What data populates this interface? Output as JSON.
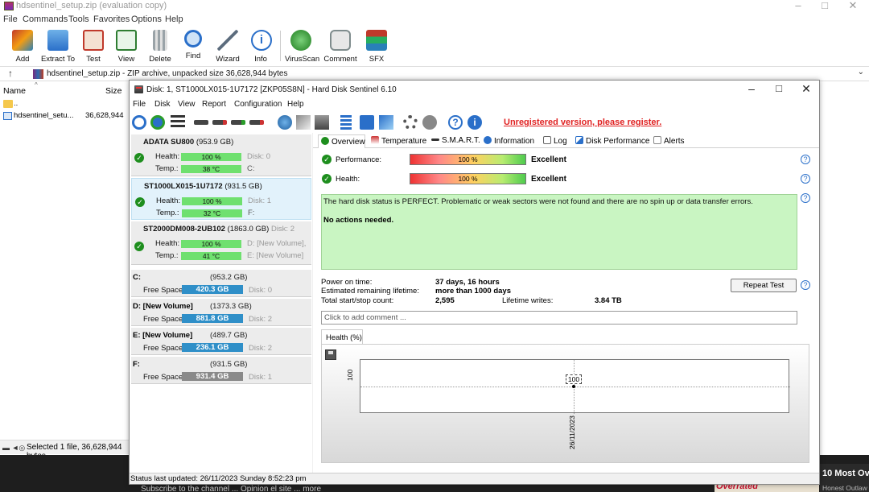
{
  "rar": {
    "title": "hdsentinel_setup.zip (evaluation copy)",
    "menu": [
      "File",
      "Commands",
      "Tools",
      "Favorites",
      "Options",
      "Help"
    ],
    "toolbar": [
      {
        "label": "Add",
        "icon": "add-archive-icon",
        "color": "#c0392b"
      },
      {
        "label": "Extract To",
        "icon": "folder-extract-icon",
        "color": "#3a87c9"
      },
      {
        "label": "Test",
        "icon": "test-clipboard-icon",
        "color": "#c0392b"
      },
      {
        "label": "View",
        "icon": "book-view-icon",
        "color": "#2e7d32"
      },
      {
        "label": "Delete",
        "icon": "trash-icon",
        "color": "#7f8c8d"
      },
      {
        "label": "Find",
        "icon": "magnifier-icon",
        "color": "#2a6fc9"
      },
      {
        "label": "Wizard",
        "icon": "wand-icon",
        "color": "#5d6d7e"
      },
      {
        "label": "Info",
        "icon": "info-icon",
        "color": "#2a6fc9"
      },
      {
        "label": "VirusScan",
        "icon": "virus-scan-icon",
        "color": "#2e9d2e"
      },
      {
        "label": "Comment",
        "icon": "comment-icon",
        "color": "#7f8c8d"
      },
      {
        "label": "SFX",
        "icon": "sfx-icon",
        "color": "#c0392b"
      }
    ],
    "path": "hdsentinel_setup.zip - ZIP archive, unpacked size 36,628,944 bytes",
    "columns": {
      "name": "Name",
      "size": "Size"
    },
    "files": [
      {
        "name": "..",
        "size": ""
      },
      {
        "name": "hdsentinel_setu...",
        "size": "36,628,944"
      }
    ],
    "status": "Selected 1 file, 36,628,944 bytes"
  },
  "taskbar": {
    "thumb_title": "10 Most Ove",
    "thumb_sub": "Honest Outlaw",
    "overrated": "Overrated",
    "subscribe": "Subscribe to the channel ... Opinion el site ... more"
  },
  "hds": {
    "title": "Disk: 1, ST1000LX015-1U7172 [ZKP05S8N]  -  Hard Disk Sentinel 6.10",
    "menu": [
      "File",
      "Disk",
      "View",
      "Report",
      "Configuration",
      "Help"
    ],
    "unregistered": "Unregistered version, please register.",
    "disks": [
      {
        "name": "ADATA SU800",
        "size": "(953.9 GB)",
        "health": "100 %",
        "temp": "38 °C",
        "disk": "Disk: 0",
        "drive": "C:",
        "health_pct": 100
      },
      {
        "name": "ST1000LX015-1U7172",
        "size": "(931.5 GB)",
        "health": "100 %",
        "temp": "32 °C",
        "disk": "Disk: 1",
        "drive": "F:",
        "health_pct": 100
      },
      {
        "name": "ST2000DM008-2UB102",
        "size": "(1863.0 GB)",
        "extra": "Disk: 2",
        "health": "100 %",
        "temp": "41 °C",
        "disk": "D: [New Volume],",
        "drive": "E: [New Volume]",
        "health_pct": 100
      }
    ],
    "labels": {
      "health": "Health:",
      "temp": "Temp.:",
      "free": "Free Space"
    },
    "drives": [
      {
        "name": "C:",
        "size": "(953.2 GB)",
        "free": "420.3 GB",
        "disk": "Disk: 0"
      },
      {
        "name": "D: [New Volume]",
        "size": "(1373.3 GB)",
        "free": "881.8 GB",
        "disk": "Disk: 2"
      },
      {
        "name": "E: [New Volume]",
        "size": "(489.7 GB)",
        "free": "236.1 GB",
        "disk": "Disk: 2"
      },
      {
        "name": "F:",
        "size": "(931.5 GB)",
        "free": "931.4 GB",
        "disk": "Disk: 1"
      }
    ],
    "tabs": [
      "Overview",
      "Temperature",
      "S.M.A.R.T.",
      "Information",
      "Log",
      "Disk Performance",
      "Alerts"
    ],
    "overview": {
      "performance_label": "Performance:",
      "performance_value": "100 %",
      "performance_rating": "Excellent",
      "health_label": "Health:",
      "health_value": "100 %",
      "health_rating": "Excellent",
      "status_text": "The hard disk status is PERFECT. Problematic or weak sectors were not found and there are no spin up or data transfer errors.",
      "actions": "No actions needed.",
      "power_on_label": "Power on time:",
      "power_on_value": "37 days, 16 hours",
      "remaining_label": "Estimated remaining lifetime:",
      "remaining_value": "more than 1000 days",
      "startstop_label": "Total start/stop count:",
      "startstop_value": "2,595",
      "writes_label": "Lifetime writes:",
      "writes_value": "3.84 TB",
      "repeat_button": "Repeat Test",
      "comment_placeholder": "Click to add comment ..."
    },
    "chart_tab": "Health (%)",
    "chart_data": {
      "type": "line",
      "x": [
        "26/11/2023"
      ],
      "series": [
        {
          "values": [
            100
          ]
        }
      ],
      "ylabel": "",
      "tick_label_y": "100",
      "point_label": "100",
      "x_tick": "26/11/2023"
    },
    "status": "Status last updated: 26/11/2023 Sunday 8:52:23 pm"
  }
}
